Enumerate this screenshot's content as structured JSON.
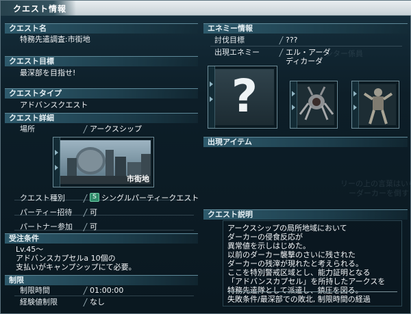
{
  "window": {
    "title": "クエスト情報"
  },
  "left": {
    "quest_name": {
      "header": "クエスト名",
      "value": "特務先遣調査:市街地"
    },
    "quest_goal": {
      "header": "クエスト目標",
      "value": "最深部を目指せ!"
    },
    "quest_type": {
      "header": "クエストタイプ",
      "value": "アドバンスクエスト"
    },
    "quest_detail": {
      "header": "クエスト詳細",
      "location_label": "場所",
      "location_value": "アークスシップ",
      "location_thumb_caption": "市街地",
      "kind_label": "クエスト種別",
      "kind_badge": "S",
      "kind_value": "シングルパーティークエスト",
      "party_label": "パーティー招待",
      "party_value": "可",
      "partner_label": "パートナー参加",
      "partner_value": "可"
    },
    "conditions": {
      "header": "受注条件",
      "lines": [
        "Lv.45～",
        "アドバンスカプセルa 10個の",
        "支払いがキャンプシップにて必要。"
      ]
    },
    "limits": {
      "header": "制限",
      "time_label": "制限時間",
      "time_value": "01:00:00",
      "exp_label": "経験値制限",
      "exp_value": "なし"
    }
  },
  "right": {
    "enemy": {
      "header": "エネミー情報",
      "target_label": "討伐目標",
      "target_value": "???",
      "appear_label": "出現エネミー",
      "appear_values": [
        "エル・アーダ",
        "ディカーダ"
      ],
      "unknown_mark": "?"
    },
    "items": {
      "header": "出現アイテム"
    },
    "description": {
      "header": "クエスト説明",
      "lines": [
        "アークスシップの局所地域において",
        "ダーカーの侵食反応が",
        "異常値を示しはじめた。",
        "以前のダーカー襲撃のさいに残された",
        "ダーカーの残滓が現れたと考えられる。",
        "ここを特別警戒区域とし、能力証明となる",
        "「アドバンスカプセル」を所持したアークスを",
        "特務先遣隊として派遣し、鎮圧を図る。"
      ],
      "failure": "失敗条件/最深部での敗北, 制限時間の経過"
    }
  },
  "colors": {
    "header_bg": "#2e5a6c",
    "badge": "#2f8a6a",
    "title_bar": "#e9eef1"
  }
}
